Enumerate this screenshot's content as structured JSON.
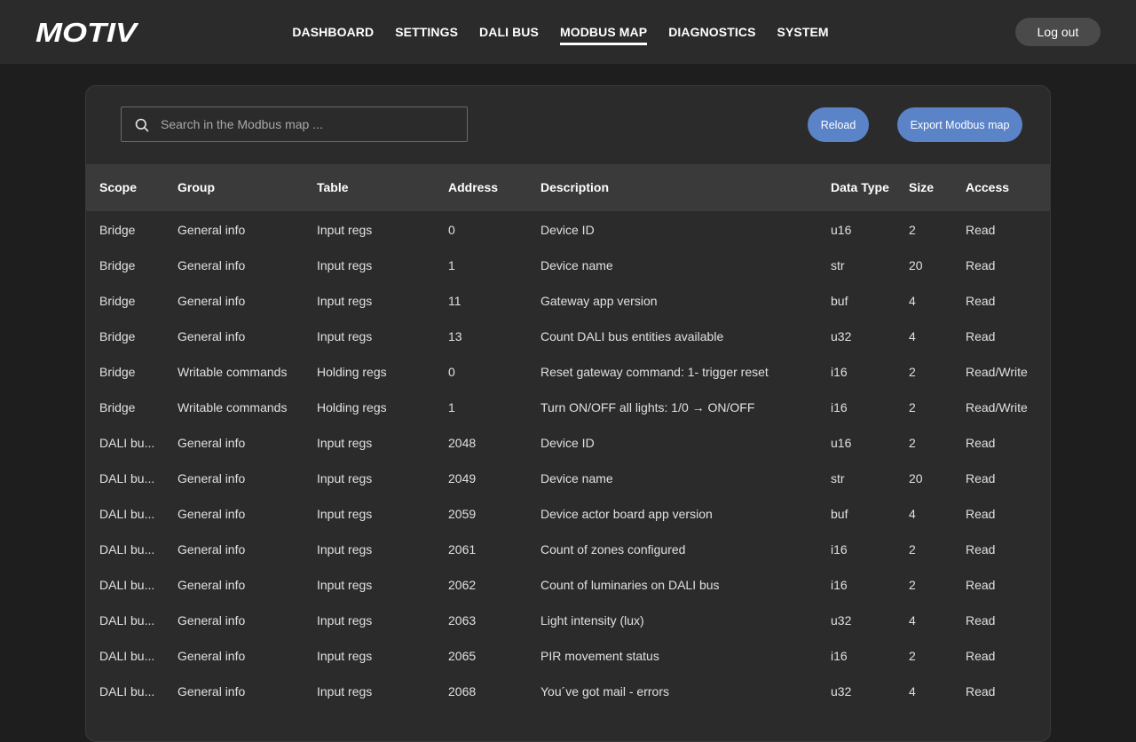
{
  "header": {
    "logo_text": "MOTIV",
    "nav": [
      {
        "label": "DASHBOARD",
        "active": false
      },
      {
        "label": "SETTINGS",
        "active": false
      },
      {
        "label": "DALI BUS",
        "active": false
      },
      {
        "label": "MODBUS MAP",
        "active": true
      },
      {
        "label": "DIAGNOSTICS",
        "active": false
      },
      {
        "label": "SYSTEM",
        "active": false
      }
    ],
    "logout_label": "Log out"
  },
  "toolbar": {
    "search_placeholder": "Search in the Modbus map ...",
    "reload_label": "Reload",
    "export_label": "Export Modbus map"
  },
  "table": {
    "columns": [
      "Scope",
      "Group",
      "Table",
      "Address",
      "Description",
      "Data Type",
      "Size",
      "Access"
    ],
    "rows": [
      [
        "Bridge",
        "General info",
        "Input regs",
        "0",
        "Device ID",
        "u16",
        "2",
        "Read"
      ],
      [
        "Bridge",
        "General info",
        "Input regs",
        "1",
        "Device name",
        "str",
        "20",
        "Read"
      ],
      [
        "Bridge",
        "General info",
        "Input regs",
        "11",
        "Gateway app version",
        "buf",
        "4",
        "Read"
      ],
      [
        "Bridge",
        "General info",
        "Input regs",
        "13",
        "Count DALI bus entities available",
        "u32",
        "4",
        "Read"
      ],
      [
        "Bridge",
        "Writable commands",
        "Holding regs",
        "0",
        "Reset gateway command: 1- trigger reset",
        "i16",
        "2",
        "Read/Write"
      ],
      [
        "Bridge",
        "Writable commands",
        "Holding regs",
        "1",
        "Turn ON/OFF all lights: 1/0 → ON/OFF",
        "i16",
        "2",
        "Read/Write"
      ],
      [
        "DALI bu...",
        "General info",
        "Input regs",
        "2048",
        "Device ID",
        "u16",
        "2",
        "Read"
      ],
      [
        "DALI bu...",
        "General info",
        "Input regs",
        "2049",
        "Device name",
        "str",
        "20",
        "Read"
      ],
      [
        "DALI bu...",
        "General info",
        "Input regs",
        "2059",
        "Device actor board app version",
        "buf",
        "4",
        "Read"
      ],
      [
        "DALI bu...",
        "General info",
        "Input regs",
        "2061",
        "Count of zones configured",
        "i16",
        "2",
        "Read"
      ],
      [
        "DALI bu...",
        "General info",
        "Input regs",
        "2062",
        "Count of luminaries on DALI bus",
        "i16",
        "2",
        "Read"
      ],
      [
        "DALI bu...",
        "General info",
        "Input regs",
        "2063",
        "Light intensity (lux)",
        "u32",
        "4",
        "Read"
      ],
      [
        "DALI bu...",
        "General info",
        "Input regs",
        "2065",
        "PIR movement status",
        "i16",
        "2",
        "Read"
      ],
      [
        "DALI bu...",
        "General info",
        "Input regs",
        "2068",
        "You´ve got mail - errors",
        "u32",
        "4",
        "Read"
      ]
    ]
  },
  "icons": {
    "search": "search-icon"
  },
  "colors": {
    "header_bg": "#2b2b2b",
    "page_bg": "#1e1e1e",
    "card_bg": "#2b2b2b",
    "table_header_bg": "#3a3a3a",
    "accent": "#5a83c8",
    "logout_bg": "#4a4a4a"
  }
}
